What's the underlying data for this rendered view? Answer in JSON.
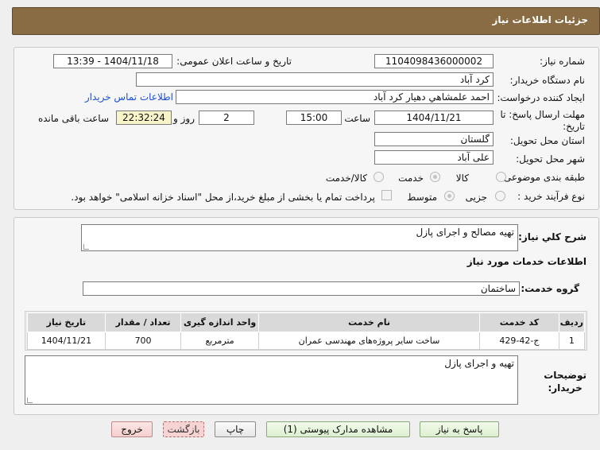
{
  "header": {
    "title": "جزئیات اطلاعات نیاز"
  },
  "form": {
    "need_number_label": "شماره نیاز:",
    "need_number": "1104098436000002",
    "announce_label": "تاریخ و ساعت اعلان عمومی:",
    "announce_value": "1404/11/18 - 13:39",
    "buyer_org_label": "نام دستگاه خریدار:",
    "buyer_org": "کرد آباد",
    "creator_label": "ایجاد کننده درخواست:",
    "creator": "احمد علمشاهي دهيار کرد آباد",
    "contact_link": "اطلاعات تماس خریدار",
    "deadline_label_1": "مهلت ارسال پاسخ: تا",
    "deadline_label_2": "تاریخ:",
    "deadline_date": "1404/11/21",
    "time_label": "ساعت",
    "deadline_time": "15:00",
    "days_value": "2",
    "days_label": "روز و",
    "remaining_time": "22:32:24",
    "remaining_label": "ساعت باقی مانده",
    "province_label": "استان محل تحویل:",
    "province": "گلستان",
    "city_label": "شهر محل تحویل:",
    "city": "علی آباد",
    "category_label": "طبقه بندی موضوعی:",
    "category_options": [
      "کالا",
      "خدمت",
      "کالا/خدمت"
    ],
    "category_selected": "خدمت",
    "process_label": "نوع فرآیند خرید :",
    "process_options": [
      "جزیی",
      "متوسط"
    ],
    "process_selected": "متوسط",
    "payment_note": "پرداخت تمام یا بخشی از مبلغ خرید،از محل \"اسناد خزانه اسلامی\" خواهد بود."
  },
  "details": {
    "summary_label": "شرح کلي نياز:",
    "summary": "تهیه مصالح و اجرای پازل",
    "services_title": "اطلاعات خدمات مورد نیاز",
    "group_label": "گروه خدمت:",
    "group": "ساختمان",
    "table": {
      "headers": [
        "ردیف",
        "کد خدمت",
        "نام خدمت",
        "واحد اندازه گیری",
        "تعداد / مقدار",
        "تاریخ نیاز"
      ],
      "rows": [
        [
          "1",
          "ج-42-429",
          "ساخت سایر پروژه‌های مهندسی عمران",
          "مترمربع",
          "700",
          "1404/11/21"
        ]
      ]
    },
    "buyer_notes_label_1": "توضیحات",
    "buyer_notes_label_2": "خریدار:",
    "buyer_notes": "تهیه و اجرای پازل"
  },
  "buttons": {
    "reply": "پاسخ به نیاز",
    "attachments": "مشاهده مدارک پیوستی (1)",
    "print": "چاپ",
    "back": "بازگشت",
    "exit": "خروج"
  },
  "colors": {
    "header_bg": "#8a6c44",
    "link": "#1b4fd6",
    "countdown_bg": "#f8f4c9"
  }
}
